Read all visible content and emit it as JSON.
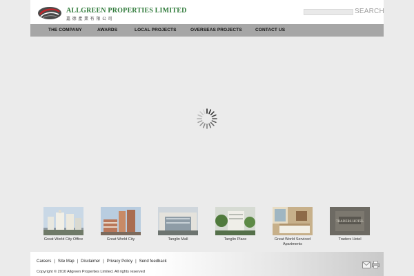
{
  "header": {
    "company_name": "ALLGREEN PROPERTIES LIMITED",
    "company_name_chinese": "嘉 德 產 業 有 限 公 司",
    "logo_icon": "allgreen-logo-icon",
    "search_label": "SEARCH",
    "search_placeholder": ""
  },
  "nav": {
    "items": [
      {
        "label": "THE COMPANY"
      },
      {
        "label": "AWARDS"
      },
      {
        "label": "LOCAL PROJECTS"
      },
      {
        "label": "OVERSEAS PROJECTS"
      },
      {
        "label": "CONTACT US"
      }
    ]
  },
  "main": {
    "loading_icon": "loading-spinner-icon"
  },
  "projects": [
    {
      "caption": "Great World City Office"
    },
    {
      "caption": "Great World City"
    },
    {
      "caption": "Tanglin Mall"
    },
    {
      "caption": "Tanglin Place"
    },
    {
      "caption": "Great World Serviced Apartments"
    },
    {
      "caption": "Traders Hotel",
      "sign_text": "TRADERS HOTEL"
    }
  ],
  "footer": {
    "links": [
      {
        "label": "Careers"
      },
      {
        "label": "Site Map"
      },
      {
        "label": "Disclaimer"
      },
      {
        "label": "Privacy Policy"
      },
      {
        "label": "Send feedback"
      }
    ],
    "separator": "|",
    "copyright": "Copyright © 2010 Allgreen Properties Limited. All rights reserved",
    "email_icon": "envelope-icon",
    "print_icon": "printer-icon"
  },
  "colors": {
    "page_background": "#ebebeb",
    "nav_background": "#a6a6a6",
    "brand_green": "#2f7a3a"
  }
}
